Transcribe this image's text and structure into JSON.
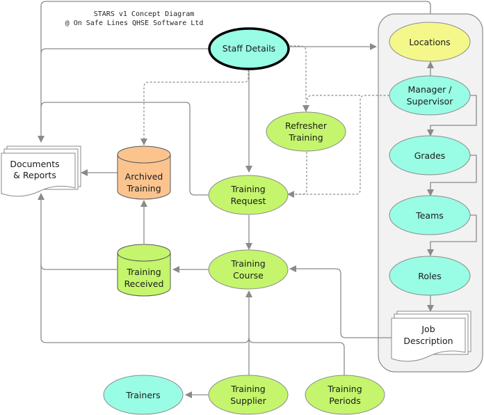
{
  "header": {
    "title_line1": "STARS v1 Concept Diagram",
    "title_line2": "@ On Safe Lines QHSE Software Ltd"
  },
  "colors": {
    "cyan": "#99fce4",
    "lime": "#c4f56d",
    "yellow": "#f4f88a",
    "orange": "#fbc48f",
    "line": "#8a8a8a",
    "group_fill": "#f2f2f2"
  },
  "nodes": {
    "staff_details": {
      "line1": "Staff Details"
    },
    "locations": {
      "line1": "Locations"
    },
    "manager": {
      "line1": "Manager /",
      "line2": "Supervisor"
    },
    "grades": {
      "line1": "Grades"
    },
    "teams": {
      "line1": "Teams"
    },
    "roles": {
      "line1": "Roles"
    },
    "job_description": {
      "line1": "Job",
      "line2": "Description"
    },
    "documents": {
      "line1": "Documents",
      "line2": "& Reports"
    },
    "archived": {
      "line1": "Archived",
      "line2": "Training"
    },
    "refresher": {
      "line1": "Refresher",
      "line2": "Training"
    },
    "request": {
      "line1": "Training",
      "line2": "Request"
    },
    "received": {
      "line1": "Training",
      "line2": "Received"
    },
    "course": {
      "line1": "Training",
      "line2": "Course"
    },
    "trainers": {
      "line1": "Trainers"
    },
    "supplier": {
      "line1": "Training",
      "line2": "Supplier"
    },
    "periods": {
      "line1": "Training",
      "line2": "Periods"
    }
  }
}
